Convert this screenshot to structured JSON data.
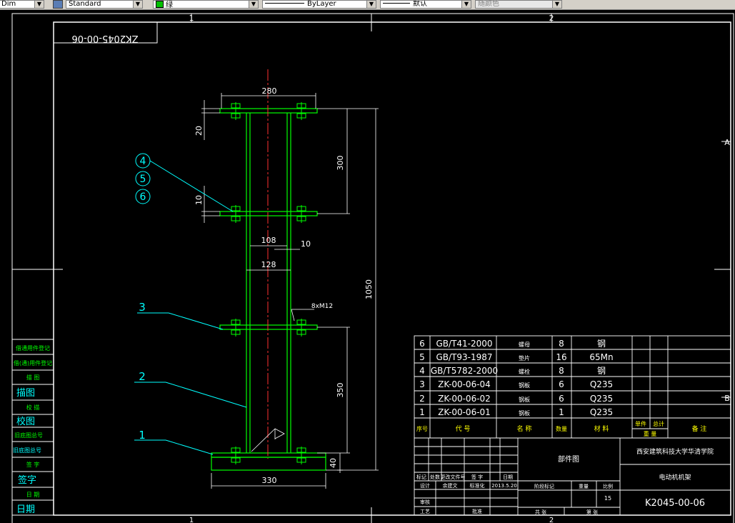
{
  "toolbar": {
    "dimstyle_value": "Dim",
    "textstyle_value": "Standard",
    "color_value": "绿",
    "color_hex": "#00c000",
    "linetype_value": "ByLayer",
    "lineweight_value": "默认",
    "plotstyle_value": "随颜色"
  },
  "drawing": {
    "zone_top_1": "1",
    "zone_top_2": "2",
    "zone_right_a": "A",
    "zone_right_b": "B",
    "zone_bottom_1": "1",
    "zone_bottom_2": "2",
    "code_box": "ZK2045-00-06",
    "dimensions": {
      "d280": "280",
      "d20": "20",
      "d300": "300",
      "d10a": "10",
      "d108": "108",
      "d10b": "10",
      "d128": "128",
      "d1050": "1050",
      "bolt": "8xM12",
      "d350": "350",
      "d40": "40",
      "d330": "330"
    },
    "balloons": [
      "4",
      "5",
      "6"
    ],
    "leader_labels": [
      "3",
      "2",
      "1"
    ],
    "left_strip": [
      "借通用件登记",
      "借(通)用件登记",
      "描 图",
      "描图",
      "校 描",
      "校图",
      "旧底图总号",
      "旧底图总号",
      "签 字",
      "签字",
      "日 期",
      "日期"
    ]
  },
  "bom": {
    "rows": [
      {
        "no": "6",
        "code": "GB/T41-2000",
        "name": "螺母",
        "qty": "8",
        "material": "钢"
      },
      {
        "no": "5",
        "code": "GB/T93-1987",
        "name": "垫片",
        "qty": "16",
        "material": "65Mn"
      },
      {
        "no": "4",
        "code": "GB/T5782-2000",
        "name": "螺栓",
        "qty": "8",
        "material": "钢"
      },
      {
        "no": "3",
        "code": "ZK-00-06-04",
        "name": "钢板",
        "qty": "6",
        "material": "Q235"
      },
      {
        "no": "2",
        "code": "ZK-00-06-02",
        "name": "钢板",
        "qty": "6",
        "material": "Q235"
      },
      {
        "no": "1",
        "code": "ZK-00-06-01",
        "name": "钢板",
        "qty": "1",
        "material": "Q235"
      }
    ],
    "headers": {
      "no": "序号",
      "code": "代 号",
      "name": "名 称",
      "qty": "数量",
      "material": "材 料",
      "single": "单件",
      "total": "总计",
      "weight": "重 量",
      "remark": "备 注"
    }
  },
  "title_block": {
    "drawing_name": "部件图",
    "school": "西安建筑科技大学华清学院",
    "part_name": "电动机机架",
    "drawing_no": "K2045-00-06",
    "date": "2013.5.20",
    "scale_value": "15",
    "marks": "标记",
    "count": "处数",
    "change_file": "更改文件号",
    "sign": "签 字",
    "date_label": "日期",
    "design": "设计",
    "standardize": "标准化",
    "stage": "阶段标记",
    "weight": "重量",
    "scale": "比例",
    "review": "审核",
    "process": "工艺",
    "approve": "批准",
    "sheets_total": "共 张",
    "sheet_no": "第 张",
    "designer_name": "余建文"
  }
}
